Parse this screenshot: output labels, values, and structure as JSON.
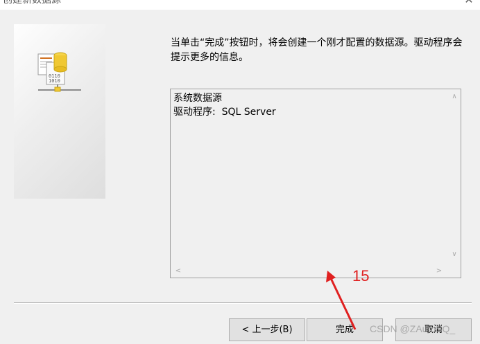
{
  "window": {
    "title": "创建新数据源",
    "close_icon": "close-icon"
  },
  "description": {
    "text": "当单击“完成”按钮时，将会创建一个刚才配置的数据源。驱动程序会提示更多的信息。"
  },
  "info_box": {
    "lines": [
      "系统数据源",
      "驱动程序:  SQL Server"
    ]
  },
  "buttons": {
    "back_label": "< 上一步(B)",
    "finish_label": "完成",
    "cancel_label": "取消"
  },
  "annotation": {
    "step_number": "15",
    "color": "#e02020"
  },
  "watermark": {
    "text": "CSDN @ZAutoSQ_"
  }
}
